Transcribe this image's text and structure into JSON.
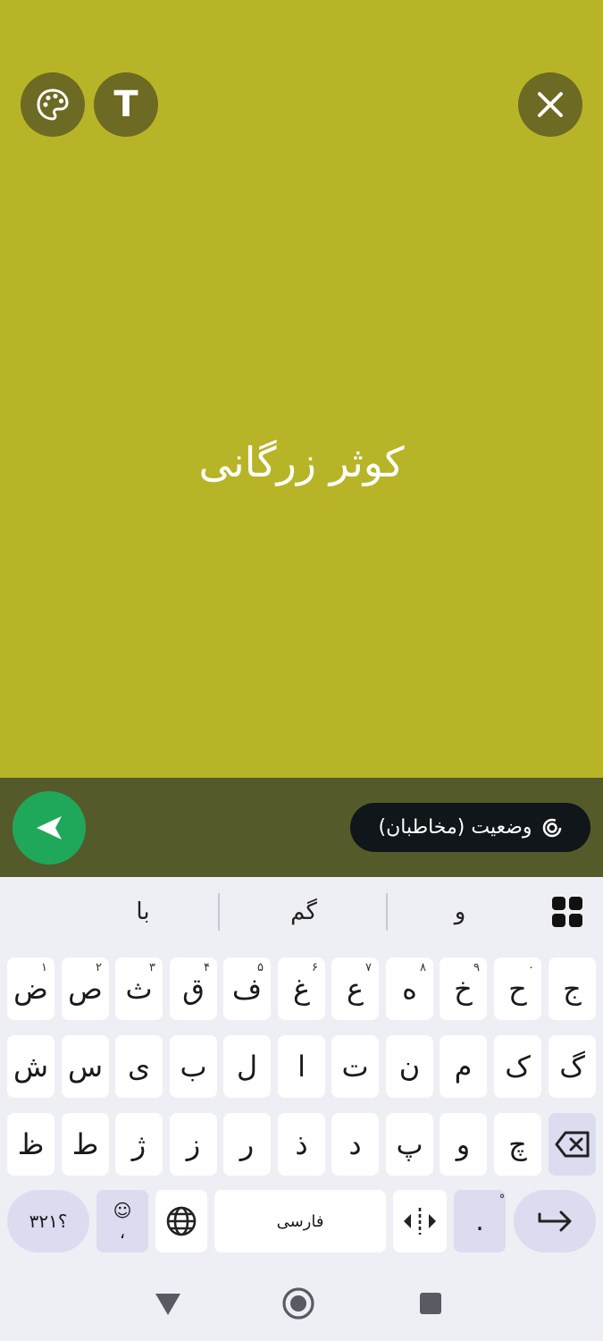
{
  "status_text": "کوثر زرگانی",
  "audience_label": "وضعیت (مخاطبان)",
  "suggestions": [
    "با",
    "گم",
    "و"
  ],
  "rows": [
    [
      {
        "char": "ض",
        "hint": "۱"
      },
      {
        "char": "ص",
        "hint": "۲"
      },
      {
        "char": "ث",
        "hint": "۳"
      },
      {
        "char": "ق",
        "hint": "۴"
      },
      {
        "char": "ف",
        "hint": "۵"
      },
      {
        "char": "غ",
        "hint": "۶"
      },
      {
        "char": "ع",
        "hint": "۷"
      },
      {
        "char": "ه",
        "hint": "۸"
      },
      {
        "char": "خ",
        "hint": "۹"
      },
      {
        "char": "ح",
        "hint": "۰"
      },
      {
        "char": "ج",
        "hint": ""
      }
    ],
    [
      {
        "char": "ش"
      },
      {
        "char": "س"
      },
      {
        "char": "ی"
      },
      {
        "char": "ب"
      },
      {
        "char": "ل"
      },
      {
        "char": "ا"
      },
      {
        "char": "ت"
      },
      {
        "char": "ن"
      },
      {
        "char": "م"
      },
      {
        "char": "ک"
      },
      {
        "char": "گ"
      }
    ],
    [
      {
        "char": "ظ"
      },
      {
        "char": "ط"
      },
      {
        "char": "ژ"
      },
      {
        "char": "ز"
      },
      {
        "char": "ر"
      },
      {
        "char": "ذ"
      },
      {
        "char": "د"
      },
      {
        "char": "پ"
      },
      {
        "char": "و"
      },
      {
        "char": "چ"
      }
    ]
  ],
  "bottom_row": {
    "symbols_label": "؟۳۲۱",
    "emoji_label": "☺",
    "comma_label": "،",
    "space_label": "فارسی",
    "period_label": ".",
    "period_hint": "ْ"
  },
  "icons": {
    "palette": "palette-icon",
    "text": "text-icon",
    "close": "close-icon",
    "send": "send-icon",
    "status": "status-ring-icon",
    "grid": "apps-grid-icon",
    "backspace": "backspace-icon",
    "globe": "globe-icon",
    "cursor": "cursor-move-icon",
    "enter": "enter-icon"
  },
  "text_button_label": "T",
  "colors": {
    "canvas_bg": "#b8b427",
    "send_green": "#1fa85a"
  }
}
